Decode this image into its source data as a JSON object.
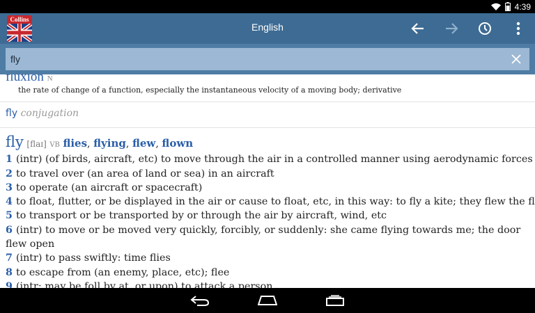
{
  "status_bar": {
    "time": "4:39"
  },
  "app_bar": {
    "brand": "Collins",
    "title": "English"
  },
  "search": {
    "value": "fly"
  },
  "results": {
    "previous": {
      "word": "fluxion",
      "pos": "N",
      "definition": "the rate of change of a function, especially the instantaneous velocity of a moving body; derivative"
    },
    "conjugation": {
      "word": "fly",
      "label": "conjugation"
    },
    "entry": {
      "headword": "fly",
      "pronunciation": "[flaɪ]",
      "pos": "VB",
      "forms": [
        "flies",
        "flying",
        "flew",
        "flown"
      ],
      "senses": [
        {
          "num": "1",
          "text": "(intr) (of birds, aircraft, etc) to move through the air in a controlled manner using aerodynamic forces"
        },
        {
          "num": "2",
          "text": "to travel over (an area of land or sea) in an aircraft"
        },
        {
          "num": "3",
          "text": "to operate (an aircraft or spacecraft)"
        },
        {
          "num": "4",
          "text": "to float, flutter, or be displayed in the air or cause to float, etc, in this way: to fly a kite; they flew the flag"
        },
        {
          "num": "5",
          "text": "to transport or be transported by or through the air by aircraft, wind, etc"
        },
        {
          "num": "6",
          "text": "(intr) to move or be moved very quickly, forcibly, or suddenly: she came flying towards me; the door flew open"
        },
        {
          "num": "7",
          "text": "(intr) to pass swiftly: time flies"
        },
        {
          "num": "8",
          "text": "to escape from (an enemy, place, etc); flee"
        },
        {
          "num": "9",
          "text": "(intr; may be foll by at, or upon) to attack a person"
        }
      ]
    }
  },
  "icons": {
    "status": [
      "wifi-icon",
      "battery-icon"
    ],
    "app_bar": [
      "flag-icon",
      "back-arrow-icon",
      "forward-arrow-icon",
      "history-icon",
      "overflow-menu-icon"
    ],
    "search": [
      "clear-icon"
    ],
    "nav": [
      "nav-back-icon",
      "nav-home-icon",
      "nav-recents-icon"
    ]
  },
  "colors": {
    "app_bar": "#3d6b93",
    "search_bar": "#4e7ca5",
    "search_field": "#9cb8d4",
    "link_blue": "#2a5ea8",
    "brand_red": "#c8282e"
  }
}
